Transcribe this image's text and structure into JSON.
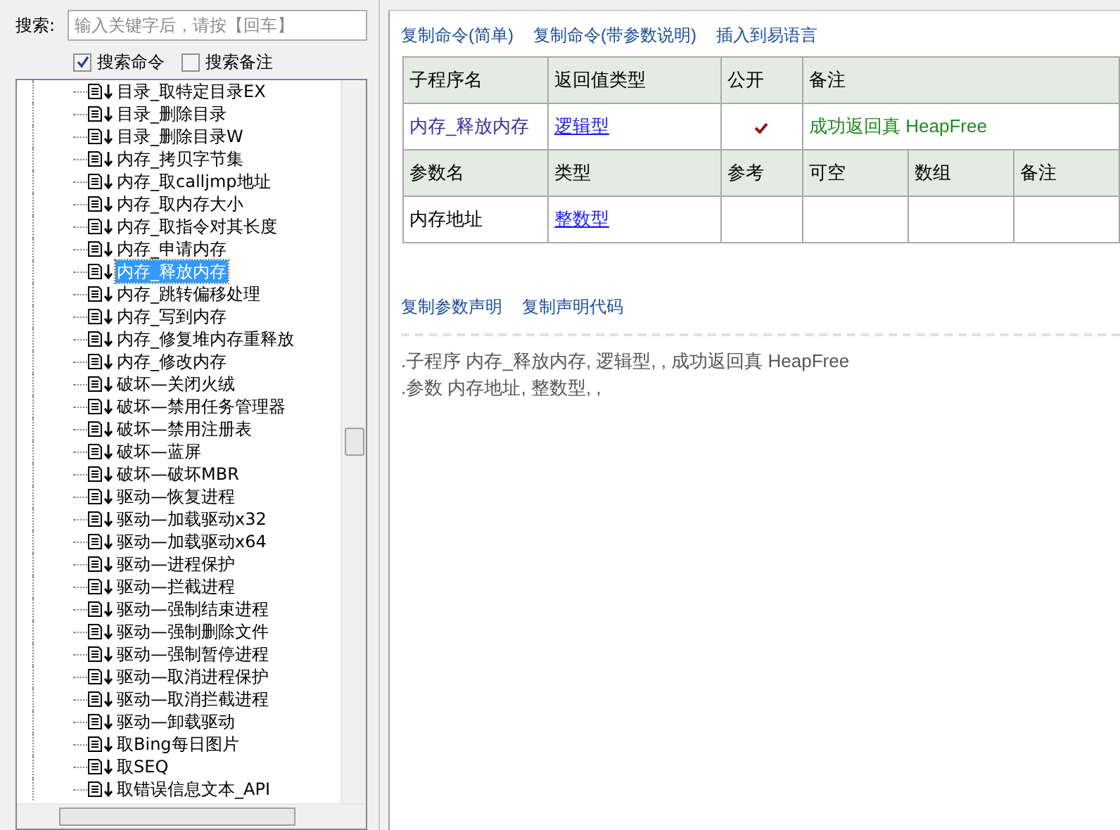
{
  "search": {
    "label": "搜索:",
    "placeholder": "输入关键字后，请按【回车】"
  },
  "options": [
    {
      "label": "搜索命令",
      "checked": true
    },
    {
      "label": "搜索备注",
      "checked": false
    }
  ],
  "tree": {
    "items": [
      {
        "label": "目录_取特定目录EX",
        "selected": false
      },
      {
        "label": "目录_删除目录",
        "selected": false
      },
      {
        "label": "目录_删除目录W",
        "selected": false
      },
      {
        "label": "内存_拷贝字节集",
        "selected": false
      },
      {
        "label": "内存_取calljmp地址",
        "selected": false
      },
      {
        "label": "内存_取内存大小",
        "selected": false
      },
      {
        "label": "内存_取指令对其长度",
        "selected": false
      },
      {
        "label": "内存_申请内存",
        "selected": false
      },
      {
        "label": "内存_释放内存",
        "selected": true
      },
      {
        "label": "内存_跳转偏移处理",
        "selected": false
      },
      {
        "label": "内存_写到内存",
        "selected": false
      },
      {
        "label": "内存_修复堆内存重释放",
        "selected": false
      },
      {
        "label": "内存_修改内存",
        "selected": false
      },
      {
        "label": "破坏—关闭火绒",
        "selected": false
      },
      {
        "label": "破坏—禁用任务管理器",
        "selected": false
      },
      {
        "label": "破坏—禁用注册表",
        "selected": false
      },
      {
        "label": "破坏—蓝屏",
        "selected": false
      },
      {
        "label": "破坏—破坏MBR",
        "selected": false
      },
      {
        "label": "驱动—恢复进程",
        "selected": false
      },
      {
        "label": "驱动—加载驱动x32",
        "selected": false
      },
      {
        "label": "驱动—加载驱动x64",
        "selected": false
      },
      {
        "label": "驱动—进程保护",
        "selected": false
      },
      {
        "label": "驱动—拦截进程",
        "selected": false
      },
      {
        "label": "驱动—强制结束进程",
        "selected": false
      },
      {
        "label": "驱动—强制删除文件",
        "selected": false
      },
      {
        "label": "驱动—强制暂停进程",
        "selected": false
      },
      {
        "label": "驱动—取消进程保护",
        "selected": false
      },
      {
        "label": "驱动—取消拦截进程",
        "selected": false
      },
      {
        "label": "驱动—卸载驱动",
        "selected": false
      },
      {
        "label": "取Bing每日图片",
        "selected": false
      },
      {
        "label": "取SEQ",
        "selected": false
      },
      {
        "label": "取错误信息文本_API",
        "selected": false
      }
    ]
  },
  "top_links": [
    "复制命令(简单)",
    "复制命令(带参数说明)",
    "插入到易语言"
  ],
  "sub_table": {
    "columns": [
      "子程序名",
      "返回值类型",
      "公开",
      "备注"
    ],
    "row": {
      "name": "内存_释放内存",
      "type": "逻辑型",
      "public": true,
      "note": "成功返回真 HeapFree"
    }
  },
  "param_table": {
    "columns": [
      "参数名",
      "类型",
      "参考",
      "可空",
      "数组",
      "备注"
    ],
    "rows": [
      {
        "name": "内存地址",
        "type": "整数型"
      }
    ]
  },
  "bottom_links": [
    "复制参数声明",
    "复制声明代码"
  ],
  "code_lines": [
    ".子程序 内存_释放内存, 逻辑型, , 成功返回真 HeapFree",
    ".参数 内存地址, 整数型, ,"
  ]
}
